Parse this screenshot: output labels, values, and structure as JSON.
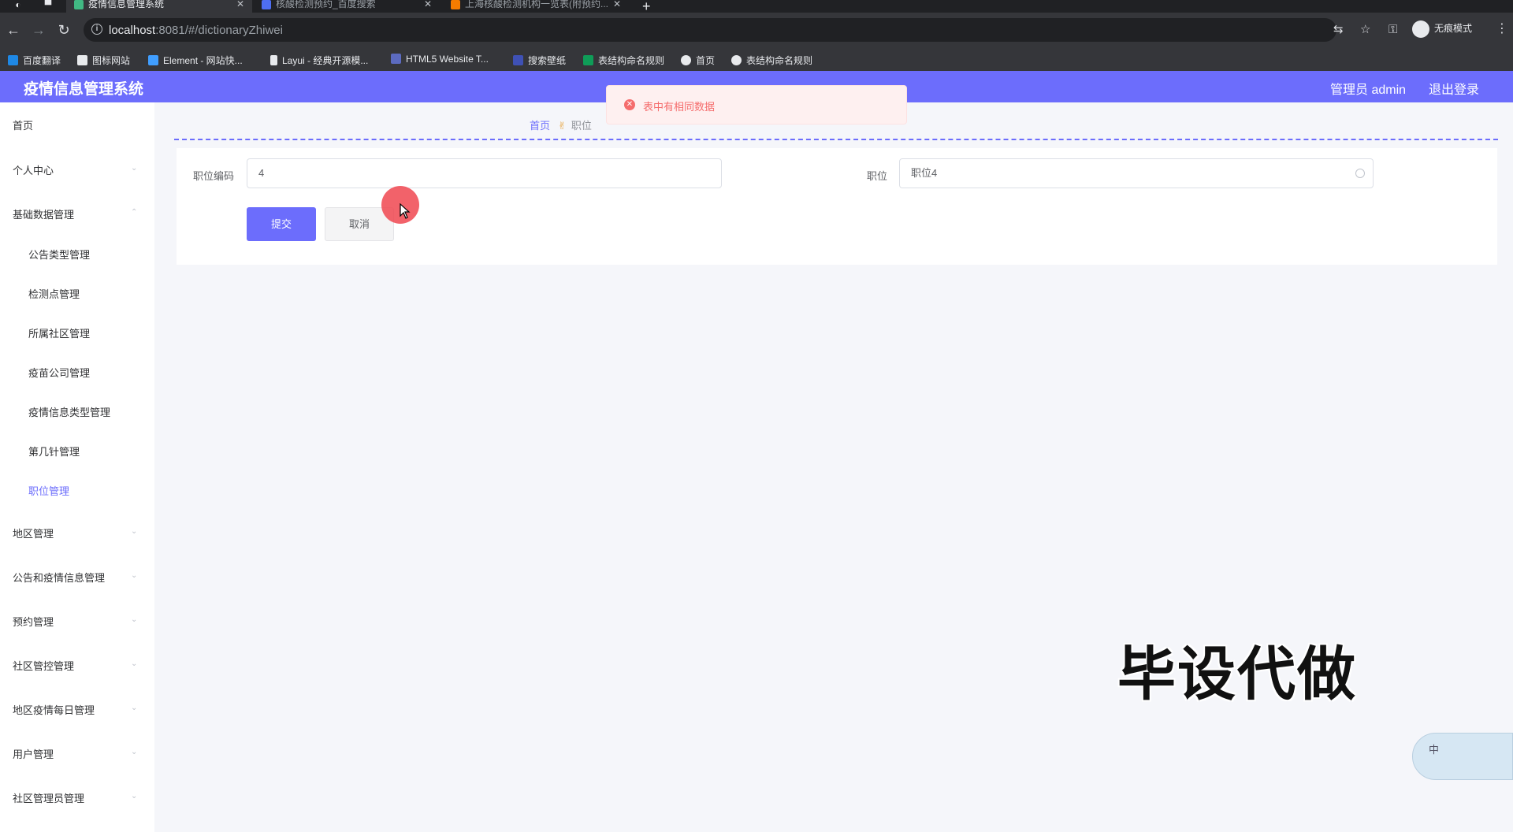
{
  "browser": {
    "tabs": [
      {
        "title": "疫情信息管理系统",
        "active": true
      },
      {
        "title": "核酸检测预约_百度搜索",
        "active": false
      },
      {
        "title": "上海核酸检测机构一览表(附预约...",
        "active": false
      }
    ],
    "url_host": "localhost",
    "url_rest": ":8081/#/dictionaryZhiwei",
    "profile_label": "无痕模式",
    "bookmarks": [
      {
        "label": "百度翻译",
        "color": "#1e88e5"
      },
      {
        "label": "图标网站",
        "color": "#e8eaed"
      },
      {
        "label": "Element - 网站快...",
        "color": "#409eff"
      },
      {
        "label": "Layui - 经典开源模...",
        "color": "#e8eaed"
      },
      {
        "label": "HTML5 Website T...",
        "color": "#5c6bc0"
      },
      {
        "label": "搜索壁纸",
        "color": "#3f51b5"
      },
      {
        "label": "表结构命名规则",
        "color": "#0f9d58"
      },
      {
        "label": "首页",
        "color": "#e8eaed"
      },
      {
        "label": "表结构命名规则",
        "color": "#e8eaed"
      }
    ]
  },
  "header": {
    "title": "疫情信息管理系统",
    "user": "管理员 admin",
    "logout": "退出登录",
    "accent_color": "#6c6dfc"
  },
  "sidebar": {
    "home": "首页",
    "personal": "个人中心",
    "basic_data": "基础数据管理",
    "sub_items": [
      "公告类型管理",
      "检测点管理",
      "所属社区管理",
      "疫苗公司管理",
      "疫情信息类型管理",
      "第几针管理",
      "职位管理"
    ],
    "groups": [
      "地区管理",
      "公告和疫情信息管理",
      "预约管理",
      "社区管控管理",
      "地区疫情每日管理",
      "用户管理",
      "社区管理员管理"
    ]
  },
  "breadcrumb": {
    "home": "首页",
    "current": "职位"
  },
  "form": {
    "code_label": "职位编码",
    "code_value": "4",
    "name_label": "职位",
    "name_value": "职位4",
    "submit": "提交",
    "cancel": "取消"
  },
  "toast": {
    "message": "表中有相同数据",
    "color": "#f56c6c"
  },
  "watermark": "毕设代做",
  "float_widget": "中"
}
